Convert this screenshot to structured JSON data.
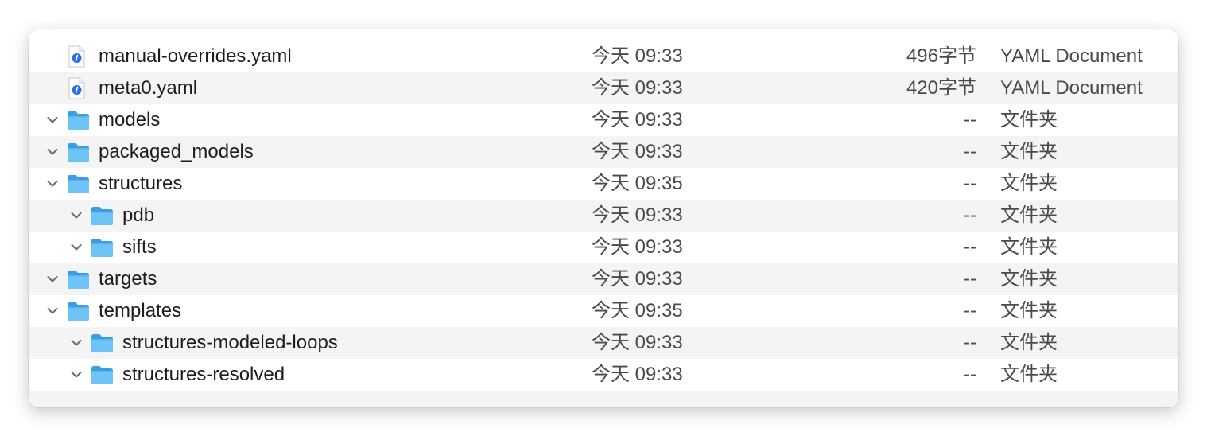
{
  "files": [
    {
      "name": "manual-overrides.yaml",
      "date": "今天 09:33",
      "size": "496字节",
      "kind": "YAML Document",
      "type": "yaml",
      "indent": 0,
      "expanded": false
    },
    {
      "name": "meta0.yaml",
      "date": "今天 09:33",
      "size": "420字节",
      "kind": "YAML Document",
      "type": "yaml",
      "indent": 0,
      "expanded": false
    },
    {
      "name": "models",
      "date": "今天 09:33",
      "size": "--",
      "kind": "文件夹",
      "type": "folder",
      "indent": 0,
      "expanded": true
    },
    {
      "name": "packaged_models",
      "date": "今天 09:33",
      "size": "--",
      "kind": "文件夹",
      "type": "folder",
      "indent": 0,
      "expanded": true
    },
    {
      "name": "structures",
      "date": "今天 09:35",
      "size": "--",
      "kind": "文件夹",
      "type": "folder",
      "indent": 0,
      "expanded": true
    },
    {
      "name": "pdb",
      "date": "今天 09:33",
      "size": "--",
      "kind": "文件夹",
      "type": "folder",
      "indent": 1,
      "expanded": true
    },
    {
      "name": "sifts",
      "date": "今天 09:33",
      "size": "--",
      "kind": "文件夹",
      "type": "folder",
      "indent": 1,
      "expanded": true
    },
    {
      "name": "targets",
      "date": "今天 09:33",
      "size": "--",
      "kind": "文件夹",
      "type": "folder",
      "indent": 0,
      "expanded": true
    },
    {
      "name": "templates",
      "date": "今天 09:35",
      "size": "--",
      "kind": "文件夹",
      "type": "folder",
      "indent": 0,
      "expanded": true
    },
    {
      "name": "structures-modeled-loops",
      "date": "今天 09:33",
      "size": "--",
      "kind": "文件夹",
      "type": "folder",
      "indent": 1,
      "expanded": true
    },
    {
      "name": "structures-resolved",
      "date": "今天 09:33",
      "size": "--",
      "kind": "文件夹",
      "type": "folder",
      "indent": 1,
      "expanded": true
    }
  ],
  "colors": {
    "folder_body": "#58b7f3",
    "folder_tab": "#3d9de4",
    "folder_front": "#6ec3f7",
    "yaml_badge": "#2f6fe0",
    "row_alt": "#f4f4f5",
    "chevron": "#6b6b6f"
  },
  "icons": {
    "folder": "folder-icon",
    "yaml": "yaml-document-icon",
    "chevron": "chevron-down-icon"
  }
}
